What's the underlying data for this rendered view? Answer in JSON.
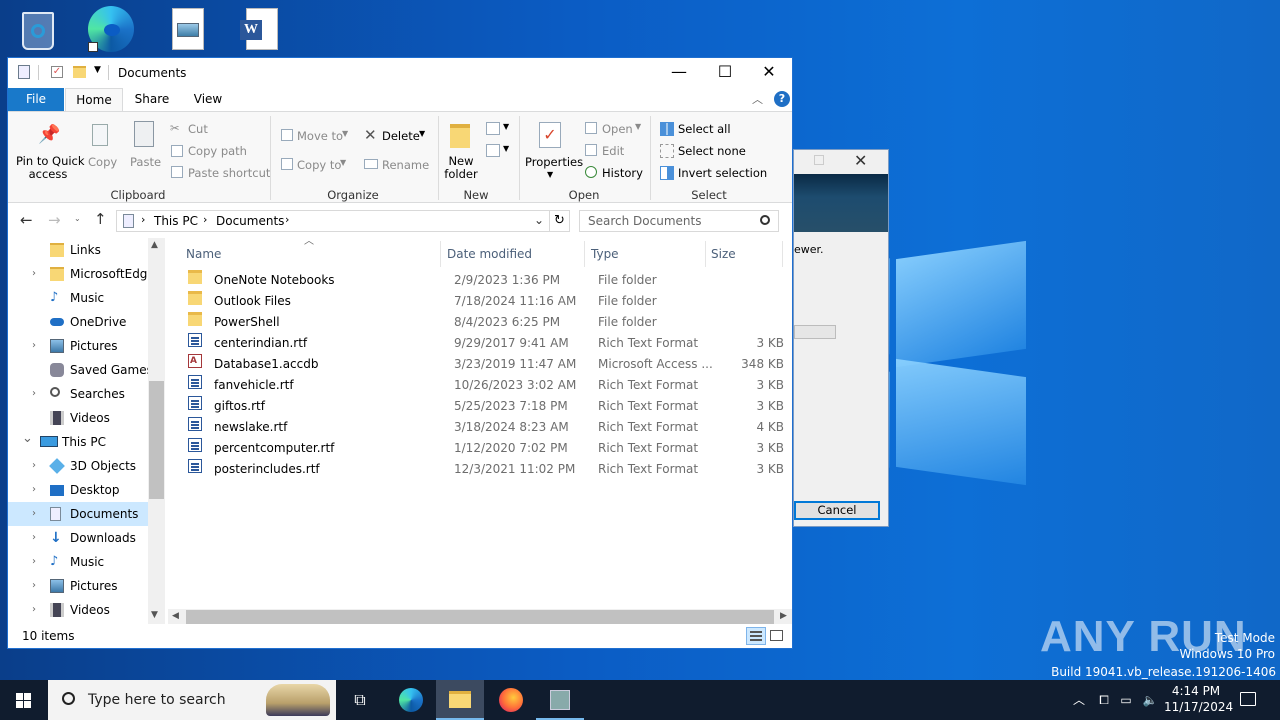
{
  "desktop": {
    "icons": [
      "recycle-bin-icon",
      "edge-icon",
      "image-file-icon",
      "word-doc-icon"
    ]
  },
  "background_dialog": {
    "text_fragment": "ewer.",
    "cancel_label": "Cancel"
  },
  "window": {
    "title": "Documents",
    "controls": {
      "minimize": "—",
      "maximize": "☐",
      "close": "✕"
    }
  },
  "tabs": [
    {
      "label": "File"
    },
    {
      "label": "Home"
    },
    {
      "label": "Share"
    },
    {
      "label": "View"
    }
  ],
  "ribbon": {
    "clipboard": {
      "pin_label_1": "Pin to Quick",
      "pin_label_2": "access",
      "copy": "Copy",
      "paste": "Paste",
      "cut": "Cut",
      "copy_path": "Copy path",
      "paste_shortcut": "Paste shortcut",
      "group": "Clipboard"
    },
    "organize": {
      "move_to": "Move to",
      "copy_to": "Copy to",
      "delete": "Delete",
      "rename": "Rename",
      "group": "Organize"
    },
    "new": {
      "new_folder_1": "New",
      "new_folder_2": "folder",
      "group": "New"
    },
    "open": {
      "properties": "Properties",
      "open": "Open",
      "edit": "Edit",
      "history": "History",
      "group": "Open"
    },
    "select": {
      "select_all": "Select all",
      "select_none": "Select none",
      "invert": "Invert selection",
      "group": "Select"
    }
  },
  "address": {
    "crumbs": [
      "This PC",
      "Documents"
    ],
    "search_placeholder": "Search Documents"
  },
  "nav": [
    {
      "label": "Links",
      "chev": ""
    },
    {
      "label": "MicrosoftEdge",
      "chev": "›"
    },
    {
      "label": "Music",
      "chev": ""
    },
    {
      "label": "OneDrive",
      "chev": ""
    },
    {
      "label": "Pictures",
      "chev": "›"
    },
    {
      "label": "Saved Games",
      "chev": ""
    },
    {
      "label": "Searches",
      "chev": "›"
    },
    {
      "label": "Videos",
      "chev": ""
    },
    {
      "label": "This PC",
      "chev": "⌄"
    },
    {
      "label": "3D Objects",
      "chev": "›"
    },
    {
      "label": "Desktop",
      "chev": "›"
    },
    {
      "label": "Documents",
      "chev": "›"
    },
    {
      "label": "Downloads",
      "chev": "›"
    },
    {
      "label": "Music",
      "chev": "›"
    },
    {
      "label": "Pictures",
      "chev": "›"
    },
    {
      "label": "Videos",
      "chev": "›"
    }
  ],
  "columns": {
    "name": "Name",
    "date": "Date modified",
    "type": "Type",
    "size": "Size"
  },
  "files": [
    {
      "name": "OneNote Notebooks",
      "date": "2/9/2023 1:36 PM",
      "type": "File folder",
      "size": "",
      "kind": "folder"
    },
    {
      "name": "Outlook Files",
      "date": "7/18/2024 11:16 AM",
      "type": "File folder",
      "size": "",
      "kind": "folder"
    },
    {
      "name": "PowerShell",
      "date": "8/4/2023 6:25 PM",
      "type": "File folder",
      "size": "",
      "kind": "folder"
    },
    {
      "name": "centerindian.rtf",
      "date": "9/29/2017 9:41 AM",
      "type": "Rich Text Format",
      "size": "3 KB",
      "kind": "rtf"
    },
    {
      "name": "Database1.accdb",
      "date": "3/23/2019 11:47 AM",
      "type": "Microsoft Access ...",
      "size": "348 KB",
      "kind": "acc"
    },
    {
      "name": "fanvehicle.rtf",
      "date": "10/26/2023 3:02 AM",
      "type": "Rich Text Format",
      "size": "3 KB",
      "kind": "rtf"
    },
    {
      "name": "giftos.rtf",
      "date": "5/25/2023 7:18 PM",
      "type": "Rich Text Format",
      "size": "3 KB",
      "kind": "rtf"
    },
    {
      "name": "newslake.rtf",
      "date": "3/18/2024 8:23 AM",
      "type": "Rich Text Format",
      "size": "4 KB",
      "kind": "rtf"
    },
    {
      "name": "percentcomputer.rtf",
      "date": "1/12/2020 7:02 PM",
      "type": "Rich Text Format",
      "size": "3 KB",
      "kind": "rtf"
    },
    {
      "name": "posterincludes.rtf",
      "date": "12/3/2021 11:02 PM",
      "type": "Rich Text Format",
      "size": "3 KB",
      "kind": "rtf"
    }
  ],
  "status": {
    "items": "10 items"
  },
  "taskbar": {
    "search_placeholder": "Type here to search",
    "time": "4:14 PM",
    "date": "11/17/2024"
  },
  "watermark": {
    "brand": "ANY RUN",
    "line1": "Test Mode",
    "line2": "Windows 10 Pro",
    "line3": "Build 19041.vb_release.191206-1406"
  }
}
